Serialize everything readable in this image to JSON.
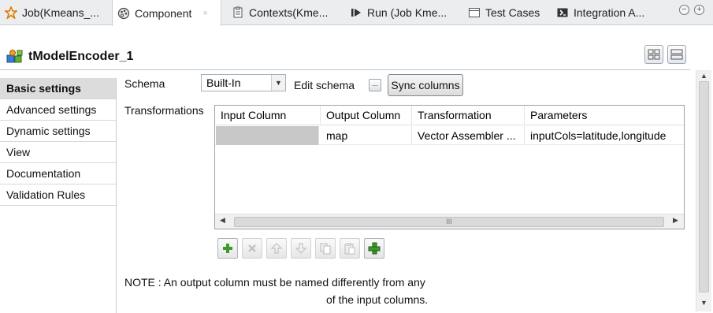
{
  "tabs": [
    {
      "label": "Job(Kmeans_...",
      "icon": "job-star-icon"
    },
    {
      "label": "Component",
      "icon": "component-palette-icon",
      "active": true
    },
    {
      "label": "Contexts(Kme...",
      "icon": "contexts-icon"
    },
    {
      "label": "Run (Job Kme...",
      "icon": "run-icon"
    },
    {
      "label": "Test Cases",
      "icon": "test-cases-icon"
    },
    {
      "label": "Integration A...",
      "icon": "integration-icon"
    }
  ],
  "tab_close": "×",
  "window_controls": {
    "minimize": "−",
    "maximize": "+"
  },
  "component": {
    "title": "tModelEncoder_1",
    "icon": "model-encoder-icon"
  },
  "sidebar": {
    "items": [
      {
        "label": "Basic settings",
        "selected": true
      },
      {
        "label": "Advanced settings"
      },
      {
        "label": "Dynamic settings"
      },
      {
        "label": "View"
      },
      {
        "label": "Documentation"
      },
      {
        "label": "Validation Rules"
      }
    ]
  },
  "schema": {
    "label": "Schema",
    "value": "Built-In",
    "edit_label": "Edit schema",
    "edit_button": "...",
    "sync_button": "Sync columns"
  },
  "transformations": {
    "label": "Transformations",
    "columns": [
      "Input Column",
      "Output Column",
      "Transformation",
      "Parameters"
    ],
    "rows": [
      {
        "input": "",
        "output": "map",
        "transformation": "Vector Assembler ...",
        "parameters": "inputCols=latitude,longitude"
      }
    ],
    "scroll_grip": "III"
  },
  "toolbar": {
    "add": "add-icon",
    "remove": "remove-icon",
    "move_up": "move-up-icon",
    "move_down": "move-down-icon",
    "copy": "copy-icon",
    "paste": "paste-icon",
    "add_selected": "add-selected-icon"
  },
  "note": {
    "line1": "NOTE : An output column must be named differently from any",
    "line2": "of the input columns."
  },
  "colors": {
    "accent_green": "#3a9a2a",
    "selected_row": "#dcdcdc",
    "empty_cell": "#c8c8c8"
  }
}
